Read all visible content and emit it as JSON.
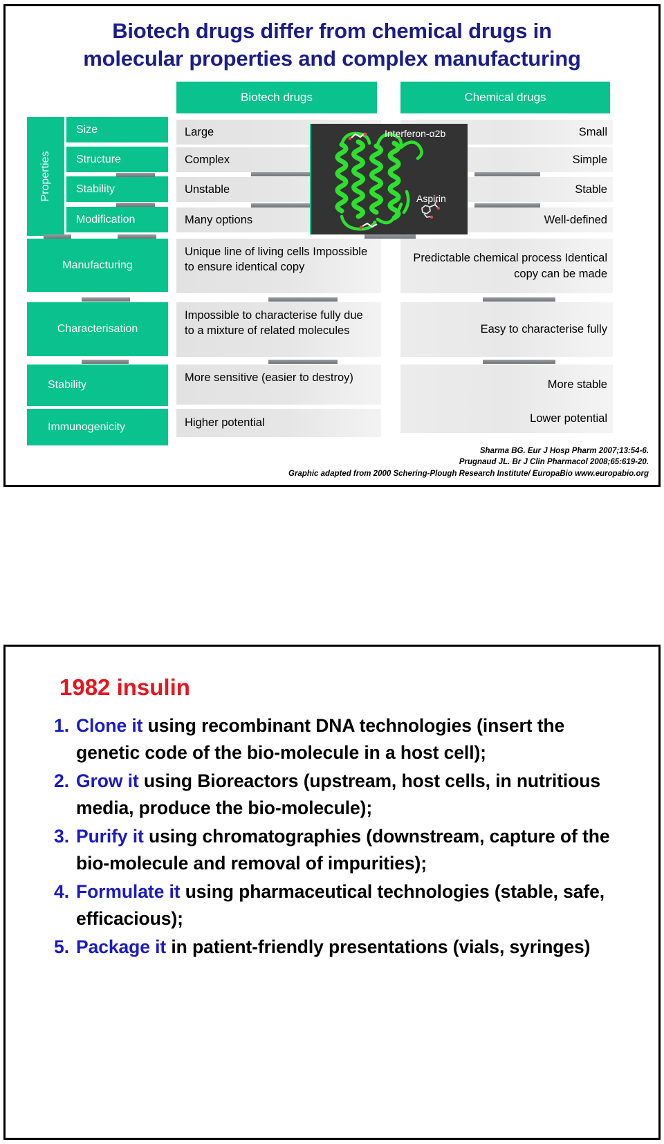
{
  "slide1": {
    "title_line1": "Biotech drugs differ from chemical drugs in",
    "title_line2": "molecular properties and complex manufacturing",
    "col_headers": {
      "biotech": "Biotech drugs",
      "chemical": "Chemical drugs"
    },
    "group_label": "Properties",
    "rows": [
      {
        "label": "Size",
        "biotech": "Large",
        "chemical": "Small"
      },
      {
        "label": "Structure",
        "biotech": "Complex",
        "chemical": "Simple"
      },
      {
        "label": "Stability",
        "biotech": "Unstable",
        "chemical": "Stable"
      },
      {
        "label": "Modification",
        "biotech": "Many options",
        "chemical": "Well-defined"
      },
      {
        "label": "Manufacturing",
        "biotech": "Unique line of living cells Impossible to ensure identical copy",
        "chemical": "Predictable chemical process Identical copy can be made"
      },
      {
        "label": "Characterisation",
        "biotech": "Impossible to characterise fully due to a mixture of related molecules",
        "chemical": "Easy to characterise fully"
      },
      {
        "label": "Stability",
        "biotech": "More sensitive (easier to destroy)",
        "chemical": "More stable"
      },
      {
        "label": "Immunogenicity",
        "biotech": "Higher potential",
        "chemical": "Lower potential"
      }
    ],
    "molecule": {
      "protein_label": "Interferon-α2b",
      "small_molecule_label": "Aspirin"
    },
    "citations": [
      "Sharma BG. Eur J Hosp Pharm 2007;13:54-6.",
      "Prugnaud JL. Br J Clin Pharmacol 2008;65:619-20.",
      "Graphic adapted from 2000 Schering-Plough Research Institute/ EuropaBio www.europabio.org"
    ],
    "colors": {
      "accent_green": "#0ac28d",
      "title_blue": "#1b1d8c",
      "panel_grey": "#e6e6e6"
    }
  },
  "slide2": {
    "heading": "1982 insulin",
    "steps": [
      {
        "num": "1.",
        "highlight": "Clone it",
        "rest": " using recombinant DNA technologies (insert the genetic code of the bio-molecule in a host cell);"
      },
      {
        "num": "2.",
        "highlight": "Grow it",
        "rest": " using Bioreactors (upstream, host cells, in nutritious media, produce the bio-molecule);"
      },
      {
        "num": "3.",
        "highlight": "Purify it",
        "rest": " using chromatographies (downstream, capture of the bio-molecule and removal of impurities);"
      },
      {
        "num": "4.",
        "highlight": "Formulate it",
        "rest": " using pharmaceutical technologies (stable, safe, efficacious);"
      },
      {
        "num": "5.",
        "highlight": "Package it",
        "rest": " in patient-friendly presentations (vials, syringes)"
      }
    ],
    "colors": {
      "heading_red": "#e8151f",
      "highlight_blue": "#1a1ac8"
    }
  }
}
